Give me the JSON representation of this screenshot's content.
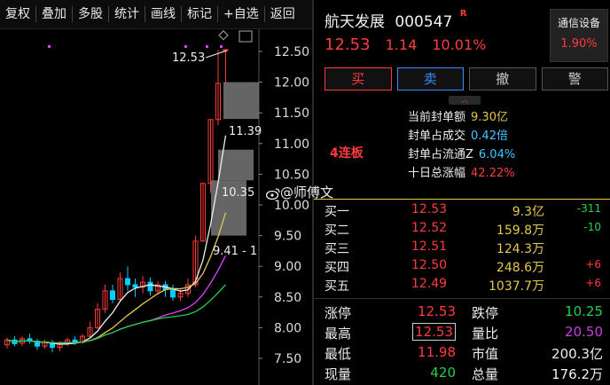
{
  "toolbar": {
    "items": [
      "复权",
      "叠加",
      "多股",
      "统计",
      "画线",
      "标记",
      "+自选",
      "返回"
    ]
  },
  "chart": {
    "y_ticks": [
      "12.50",
      "12.00",
      "11.50",
      "11.00",
      "10.50",
      "10.00",
      "9.50",
      "9.00",
      "8.50",
      "8.00",
      "7.50"
    ],
    "annotations": {
      "high": "12.53",
      "mid1": "11.39",
      "mid2": "10.35",
      "low": "9.41 - 1"
    },
    "colors": {
      "up": "#ff3b3b",
      "down": "#00d0ff",
      "ma5": "#f0f0f0",
      "ma10": "#e6c84a",
      "ma20": "#e040fb",
      "ma30": "#22d04a"
    }
  },
  "stock": {
    "name": "航天发展",
    "code": "000547",
    "flag": "R",
    "price": "12.53",
    "change": "1.14",
    "change_pct": "10.01%"
  },
  "sector_tag": {
    "name": "通信设备",
    "value": "1.90%"
  },
  "actions": {
    "buy": "买",
    "sell": "卖",
    "cancel": "撤",
    "alert": "警"
  },
  "seal": {
    "streak": "4连板",
    "rows": [
      {
        "label": "当前封单额",
        "value": "9.30亿"
      },
      {
        "label": "封单占成交",
        "value": "0.42倍"
      },
      {
        "label": "封单占流通Z",
        "value": "6.04%"
      },
      {
        "label": "十日总涨幅",
        "value": "42.22%"
      }
    ]
  },
  "order_book": [
    {
      "label": "买一",
      "price": "12.53",
      "volume": "9.3亿",
      "change": "-311"
    },
    {
      "label": "买二",
      "price": "12.52",
      "volume": "159.8万",
      "change": "-10"
    },
    {
      "label": "买三",
      "price": "12.51",
      "volume": "124.3万",
      "change": ""
    },
    {
      "label": "买四",
      "price": "12.50",
      "volume": "248.6万",
      "change": "+6"
    },
    {
      "label": "买五",
      "price": "12.49",
      "volume": "1037.7万",
      "change": "+6"
    }
  ],
  "stats": [
    {
      "l1": "涨停",
      "v1": "12.53",
      "l2": "跌停",
      "v2": "10.25"
    },
    {
      "l1": "最高",
      "v1": "12.53",
      "l2": "量比",
      "v2": "20.50"
    },
    {
      "l1": "最低",
      "v1": "11.98",
      "l2": "市值",
      "v2": "200.3亿"
    },
    {
      "l1": "现量",
      "v1": "420",
      "l2": "总量",
      "v2": "176.2万"
    }
  ],
  "watermark": "@师傅文"
}
